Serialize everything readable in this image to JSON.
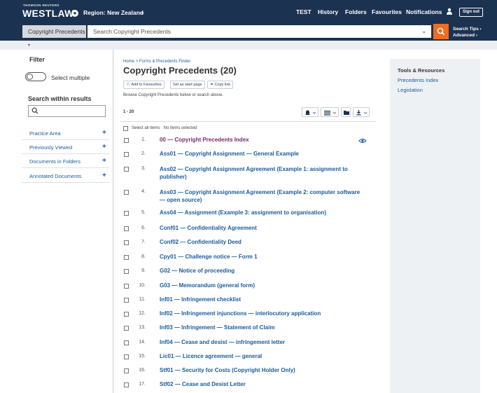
{
  "header": {
    "brand_small": "THOMSON REUTERS",
    "brand": "WESTLAW",
    "region": "Region: New Zealand",
    "nav": [
      "TEST",
      "History",
      "Folders",
      "Favourites",
      "Notifications"
    ],
    "signout": "Sign out"
  },
  "search": {
    "scope": "Copyright Precedents",
    "placeholder": "Search Copyright Precedents",
    "tips_line1": "Search Tips ›",
    "tips_line2": "Advanced ›"
  },
  "sidebar": {
    "filter_title": "Filter",
    "select_multiple": "Select multiple",
    "search_within_title": "Search within results",
    "facets": [
      "Practice Area",
      "Previously Viewed",
      "Documents in Folders",
      "Annotated Documents"
    ]
  },
  "main": {
    "breadcrumb": "Home > Forms & Precedents Finder",
    "title": "Copyright Precedents (20)",
    "add_favourites": "Add to Favourites",
    "set_start": "Set as start page",
    "copy_link": "Copy link",
    "browse_hint": "Browse Copyright Precedents below or search above.",
    "range": "1 - 20",
    "select_all": "Select all items  ·  No items selected",
    "results": [
      {
        "num": "1.",
        "title": "00 — Copyright Precedents Index"
      },
      {
        "num": "2.",
        "title": "Ass01 — Copyright Assignment — General Example"
      },
      {
        "num": "3.",
        "title": "Ass02 — Copyright Assignment Agreement (Example 1: assignment to publisher)"
      },
      {
        "num": "4.",
        "title": "Ass03 — Copyright Assignment Agreement (Example 2: computer software — open source)"
      },
      {
        "num": "5.",
        "title": "Ass04 — Assignment (Example 3: assignment to organisation)"
      },
      {
        "num": "6.",
        "title": "Conf01 — Confidentiality Agreement"
      },
      {
        "num": "7.",
        "title": "Conf02 — Confidentiality Deed"
      },
      {
        "num": "8.",
        "title": "Cpy01 — Challenge notice — Form 1"
      },
      {
        "num": "9.",
        "title": "G02 — Notice of proceeding"
      },
      {
        "num": "10.",
        "title": "G03 — Memorandum (general form)"
      },
      {
        "num": "11.",
        "title": "Inf01 — Infringement checklist"
      },
      {
        "num": "12.",
        "title": "Inf02 — Infringement injunctions — interlocutory application"
      },
      {
        "num": "13.",
        "title": "Inf03 — Infringement — Statement of Claim"
      },
      {
        "num": "14.",
        "title": "Inf04 — Cease and desist — infringement letter"
      },
      {
        "num": "15.",
        "title": "Lic01 — Licence agreement — general"
      },
      {
        "num": "16.",
        "title": "Stf01 — Security for Costs (Copyright Holder Only)"
      },
      {
        "num": "17.",
        "title": "Stf02 — Cease and Desist Letter"
      }
    ]
  },
  "tools": {
    "title": "Tools & Resources",
    "links": [
      "Precedents Index",
      "Legislation"
    ]
  },
  "colors": {
    "header_bg": "#1b3250",
    "accent": "#f26c21",
    "link": "#1a5b9a",
    "visited": "#7a2a70"
  }
}
